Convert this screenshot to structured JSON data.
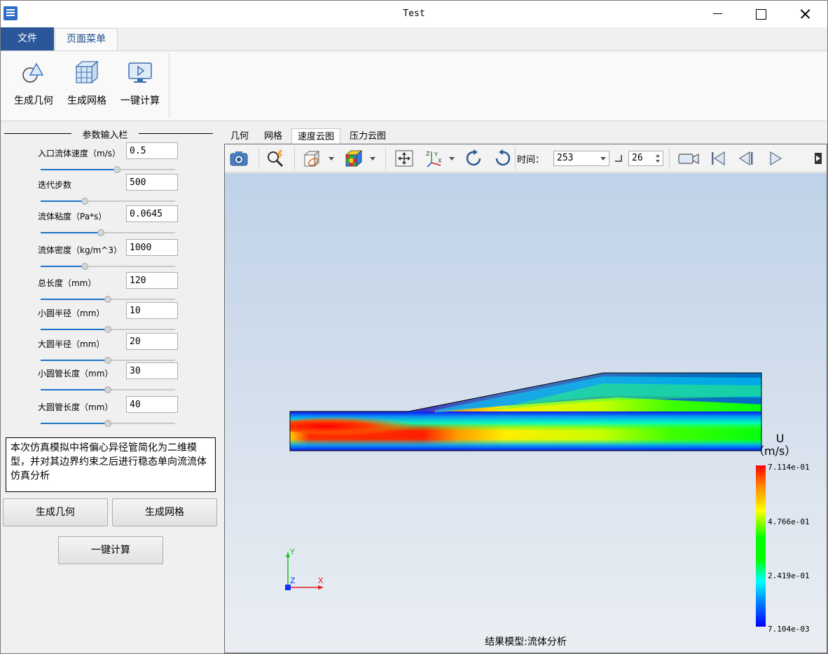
{
  "window": {
    "title": "Test"
  },
  "ribbon": {
    "tabs": [
      "文件",
      "页面菜单"
    ],
    "buttons": [
      {
        "label": "生成几何",
        "icon": "geometry-icon"
      },
      {
        "label": "生成网格",
        "icon": "mesh-icon"
      },
      {
        "label": "一键计算",
        "icon": "compute-icon"
      }
    ]
  },
  "left_panel": {
    "group_title": "参数输入栏",
    "params": [
      {
        "label": "入口流体速度（m/s）",
        "value": "0.5",
        "slider": 0.57
      },
      {
        "label": "迭代步数",
        "value": "500",
        "slider": 0.33
      },
      {
        "label": "流体粘度（Pa*s）",
        "value": "0.0645",
        "slider": 0.45
      },
      {
        "label": "流体密度（kg/m^3）",
        "value": "1000",
        "slider": 0.33
      },
      {
        "label": "总长度（mm）",
        "value": "120",
        "slider": 0.5
      },
      {
        "label": "小圆半径（mm）",
        "value": "10",
        "slider": 0.5
      },
      {
        "label": "大圆半径（mm）",
        "value": "20",
        "slider": 0.5
      },
      {
        "label": "小圆管长度（mm）",
        "value": "30",
        "slider": 0.5
      },
      {
        "label": "大圆管长度（mm）",
        "value": "40",
        "slider": 0.5
      }
    ],
    "description": "本次仿真模拟中将偏心异径管简化为二维模型，并对其边界约束之后进行稳态单向流流体仿真分析",
    "buttons": {
      "geometry": "生成几何",
      "mesh": "生成网格",
      "compute": "一键计算"
    }
  },
  "viewer": {
    "tabs": [
      "几何",
      "网格",
      "速度云图",
      "压力云图"
    ],
    "active_tab": "速度云图",
    "time_label": "时间：",
    "time_value": "253",
    "frame_value": "26",
    "legend": {
      "title_line1": "U",
      "title_line2": "（m/s）",
      "labels": [
        "7.114e-01",
        "4.766e-01",
        "2.419e-01",
        "7.104e-03"
      ]
    },
    "axes": {
      "x": "X",
      "y": "Y",
      "z": "Z"
    },
    "footer": "结果模型:流体分析"
  },
  "colors": {
    "accent": "#2b579a",
    "slider_fill": "#1a73c8"
  }
}
